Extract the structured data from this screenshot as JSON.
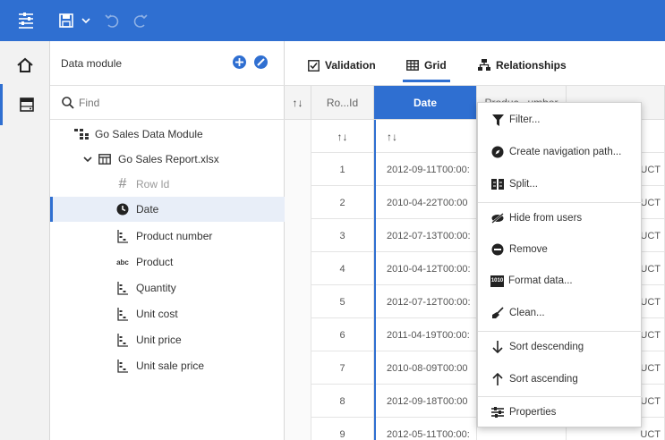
{
  "toolbar": {
    "menu_icon": "navigation-menu-icon",
    "save_icon": "save-icon",
    "undo_icon": "undo-icon",
    "redo_icon": "redo-icon",
    "accent": "#2f6fd1"
  },
  "panel": {
    "title": "Data module",
    "search_placeholder": "Find",
    "tree": [
      {
        "label": "Go Sales Data Module",
        "icon": "data-module-icon",
        "level": 1
      },
      {
        "label": "Go Sales Report.xlsx",
        "icon": "table-icon",
        "level": 2,
        "expanded": true
      },
      {
        "label": "Row Id",
        "icon": "identifier-icon",
        "level": 3,
        "dim": true
      },
      {
        "label": "Date",
        "icon": "clock-icon",
        "level": 3,
        "selected": true
      },
      {
        "label": "Product number",
        "icon": "measure-icon",
        "level": 3
      },
      {
        "label": "Product",
        "icon": "text-icon",
        "level": 3
      },
      {
        "label": "Quantity",
        "icon": "measure-icon",
        "level": 3
      },
      {
        "label": "Unit cost",
        "icon": "measure-icon",
        "level": 3
      },
      {
        "label": "Unit price",
        "icon": "measure-icon",
        "level": 3
      },
      {
        "label": "Unit sale price",
        "icon": "measure-icon",
        "level": 3
      }
    ],
    "text_icon_glyph": "abc",
    "id_icon_glyph": "#"
  },
  "tabs": [
    {
      "label": "Validation",
      "icon": "checkbox-icon"
    },
    {
      "label": "Grid",
      "icon": "grid-icon",
      "active": true
    },
    {
      "label": "Relationships",
      "icon": "relationships-icon"
    }
  ],
  "grid": {
    "headers": [
      "Ro...Id",
      "Date",
      "Produc...umber"
    ],
    "rows": [
      {
        "id": "1",
        "date": "2012-09-11T00:00:",
        "tail": "UCT"
      },
      {
        "id": "2",
        "date": "2010-04-22T00:00",
        "tail": "UCT"
      },
      {
        "id": "3",
        "date": "2012-07-13T00:00:",
        "tail": "UCT"
      },
      {
        "id": "4",
        "date": "2010-04-12T00:00:",
        "tail": "UCT"
      },
      {
        "id": "5",
        "date": "2012-07-12T00:00:",
        "tail": "UCT"
      },
      {
        "id": "6",
        "date": "2011-04-19T00:00:",
        "tail": "UCT"
      },
      {
        "id": "7",
        "date": "2010-08-09T00:00",
        "tail": "UCT"
      },
      {
        "id": "8",
        "date": "2012-09-18T00:00",
        "tail": "UCT"
      },
      {
        "id": "9",
        "date": "2012-05-11T00:00:",
        "tail": "UCT"
      }
    ]
  },
  "context_menu": {
    "items": [
      {
        "label": "Filter...",
        "icon": "filter-icon"
      },
      {
        "label": "Create navigation path...",
        "icon": "compass-icon"
      },
      {
        "label": "Split...",
        "icon": "split-icon"
      },
      {
        "label": "Hide from users",
        "icon": "hide-icon"
      },
      {
        "label": "Remove",
        "icon": "remove-icon"
      },
      {
        "label": "Format data...",
        "icon": "format-data-icon"
      },
      {
        "label": "Clean...",
        "icon": "clean-icon"
      },
      {
        "label": "Sort descending",
        "icon": "arrow-down-icon"
      },
      {
        "label": "Sort ascending",
        "icon": "arrow-up-icon"
      },
      {
        "label": "Properties",
        "icon": "properties-icon"
      }
    ],
    "format_icon_glyph": "1010"
  }
}
